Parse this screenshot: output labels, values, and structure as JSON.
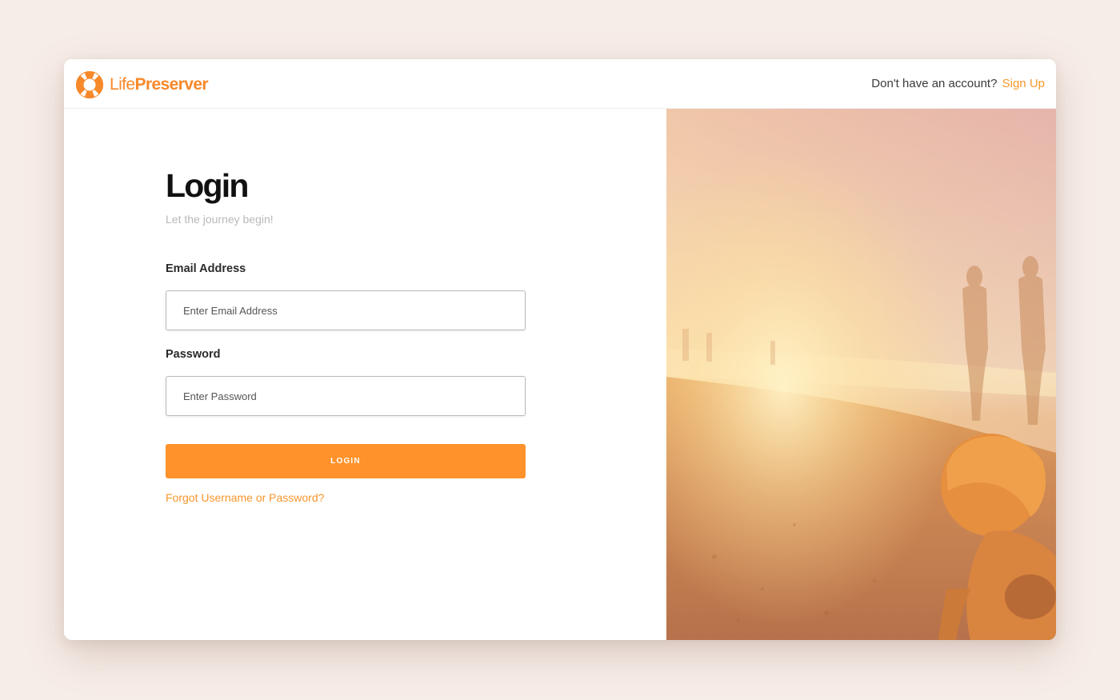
{
  "brand": {
    "name_light": "Life",
    "name_bold": "Preserver",
    "logo_icon": "lifebuoy-icon",
    "accent_color": "#f7892a"
  },
  "header": {
    "signup_prompt": "Don't have an account?",
    "signup_link": "Sign Up"
  },
  "login": {
    "title": "Login",
    "subtitle": "Let the journey begin!",
    "email": {
      "label": "Email Address",
      "placeholder": "Enter Email Address",
      "value": ""
    },
    "password": {
      "label": "Password",
      "placeholder": "Enter Password",
      "value": ""
    },
    "submit_label": "LOGIN",
    "submit_color": "#ff922a",
    "forgot_link": "Forgot Username or Password?"
  },
  "hero_image": {
    "subject": "beach-sunset-photo"
  }
}
